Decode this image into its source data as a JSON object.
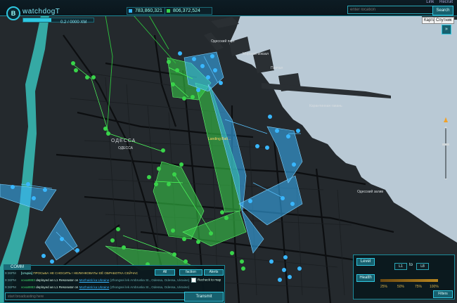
{
  "app": {
    "logo_letter": "B",
    "title": "watchdogT"
  },
  "header": {
    "progress_text": "0.2 / 0000 XM",
    "stat_resistance": "783,860,321",
    "stat_enlightened": "806,372,524",
    "links": [
      "Link",
      "Recruit"
    ],
    "search_placeholder": "enter location",
    "search_label": "Search"
  },
  "map": {
    "type_toggle": [
      "Карта",
      "Спутник"
    ],
    "city_label": "ОДЕССА",
    "city_label_small": "ОДЕССА",
    "portal_label": "Landing Batt...",
    "place_labels": [
      "Одесский порт",
      "Морской вокзал",
      "Причал",
      "Карантинная гавань",
      "Одесский залив"
    ]
  },
  "console": {
    "tab": "COMM",
    "filters": [
      "All",
      "faction",
      "Alerts"
    ],
    "rows": [
      {
        "time": "9:36PM",
        "user": "[Urupia]",
        "text": "ПРОСЬБА НЕ СНОСИТЬ ! НЕЛИНКОВАТЬ! ЕЁ ОБРАБОТКА СЕЙЧАС"
      },
      {
        "time": "9:36PM",
        "user": "vova8883",
        "action": "deployed an L1 Resonator on",
        "portal": "Mozhaisk ka Ukraine",
        "detail": "(Zhongsei lek Ambruska St., Odessa, Odessa, Ukraine)"
      },
      {
        "time": "9:36PM",
        "user": "vova8883",
        "action": "deployed an L1 Resonator on",
        "portal": "Mozhaisk ka Ukraine",
        "detail": "(Zhongsei lek Ambruska St., Odessa, Odessa, Ukraine)"
      }
    ],
    "recheck_label": "Recheck to map",
    "broadcast_placeholder": "start broadcasting here",
    "transmit_label": "Transmit"
  },
  "filters_panel": {
    "level_label": "Level",
    "level_from": "L1",
    "level_to_word": "to",
    "level_to": "L8",
    "health_label": "Health",
    "health_marks": [
      "25%",
      "50%",
      "75%",
      "100%"
    ],
    "filters_button": "Filters"
  },
  "colors": {
    "accent": "#2fc7e0",
    "resistance": "#39b7ff",
    "enlightened": "#39d44a",
    "sea": "#b7c7d3",
    "land": "#23282c"
  }
}
